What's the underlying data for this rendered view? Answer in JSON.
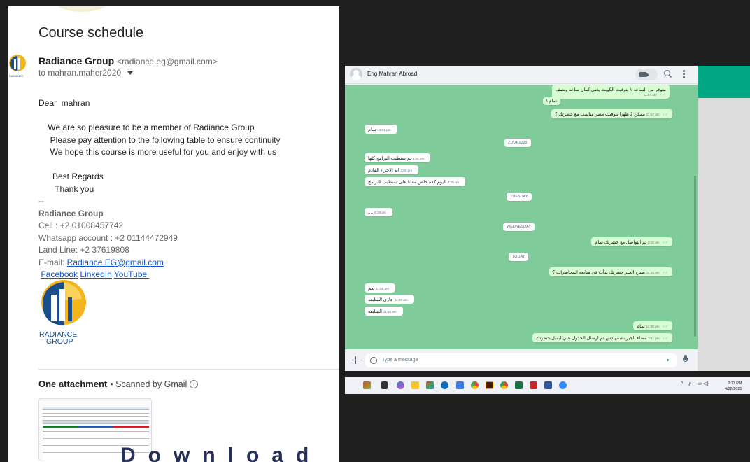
{
  "gmail": {
    "subject": "Course schedule",
    "sender_name": "Radiance Group",
    "sender_email": "<radiance.eg@gmail.com>",
    "to_line": "to mahran.maher2020",
    "body_lines": [
      "Dear  mahran",
      "",
      "    We are so pleasure to be a member of Radiance Group",
      "     Please pay attention to the following table to ensure continuity",
      "     We hope this course is more useful for you and enjoy with us",
      "",
      "      Best Regards",
      "       Thank you"
    ],
    "dashes": "--",
    "sig_name": "Radiance Group",
    "cell": "Cell : +2 01008457742",
    "whatsapp": "Whatsapp account : +2 01144472949",
    "landline": "Land Line: +2 37619808",
    "email_label": "E-mail: ",
    "email_link": "Radiance.EG@gmail.com",
    "links": [
      "Facebook",
      "LinkedIn",
      "YouTube "
    ],
    "logo_text_1": "RADIANCE",
    "logo_text_2": "GROUP",
    "attachment_title": "One attachment",
    "scanned": "• Scanned by Gmail",
    "bottom_text": "Download Ou"
  },
  "whatsapp": {
    "contact": "Eng Mahran Abroad",
    "placeholder": "Type a message",
    "messages": [
      {
        "dir": "out",
        "text": "متوفر من الساعه ١ بتوقيت الكويت يعني كمان ساعه ونصف",
        "time": "11:57 am"
      },
      {
        "dir": "out",
        "text": "تمام \\",
        "time": "11:57 am"
      },
      {
        "dir": "out",
        "text": "ممكن 2 ظهرا بتوقيت مصر مناسب مع حضرتك ؟",
        "time": "11:57 am"
      },
      {
        "dir": "in",
        "text": "تمام",
        "time": "12:01 pm"
      },
      {
        "dir": "in",
        "text": "تم تسطيب البرامج كلها",
        "time": "3:00 pm"
      },
      {
        "dir": "in",
        "text": "ابة الاجزاء القادم",
        "time": "3:00 pm"
      },
      {
        "dir": "in",
        "text": "اليوم كدة خلص معانا على تسطيب البرامج",
        "time": "3:00 pm"
      },
      {
        "dir": "in",
        "text": "....",
        "time": "8:19 am"
      },
      {
        "dir": "out",
        "text": "تم التواصل مع حضرتك تمام",
        "time": "9:15 am"
      },
      {
        "dir": "out",
        "text": "صباح الخير حضرتك بدأت في متابعه المحاضرات ؟",
        "time": "11:43 am"
      },
      {
        "dir": "in",
        "text": "نعم",
        "time": "11:59 am"
      },
      {
        "dir": "in",
        "text": "جارى المتابعه",
        "time": "11:59 am"
      },
      {
        "dir": "in",
        "text": "المتابعه",
        "time": "11:59 am"
      },
      {
        "dir": "out",
        "text": "تمام",
        "time": "12:08 pm"
      },
      {
        "dir": "out",
        "text": "مساء الخير بشمهندس تم ارسال الجدول علي ايميل حضرتك",
        "time": "2:11 pm"
      }
    ],
    "dates": [
      "21/04/2025",
      "TUESDAY",
      "WEDNESDAY",
      "TODAY"
    ]
  },
  "taskbar": {
    "tray_lang": "ع",
    "time": "2:11 PM",
    "date": "4/28/2025"
  }
}
